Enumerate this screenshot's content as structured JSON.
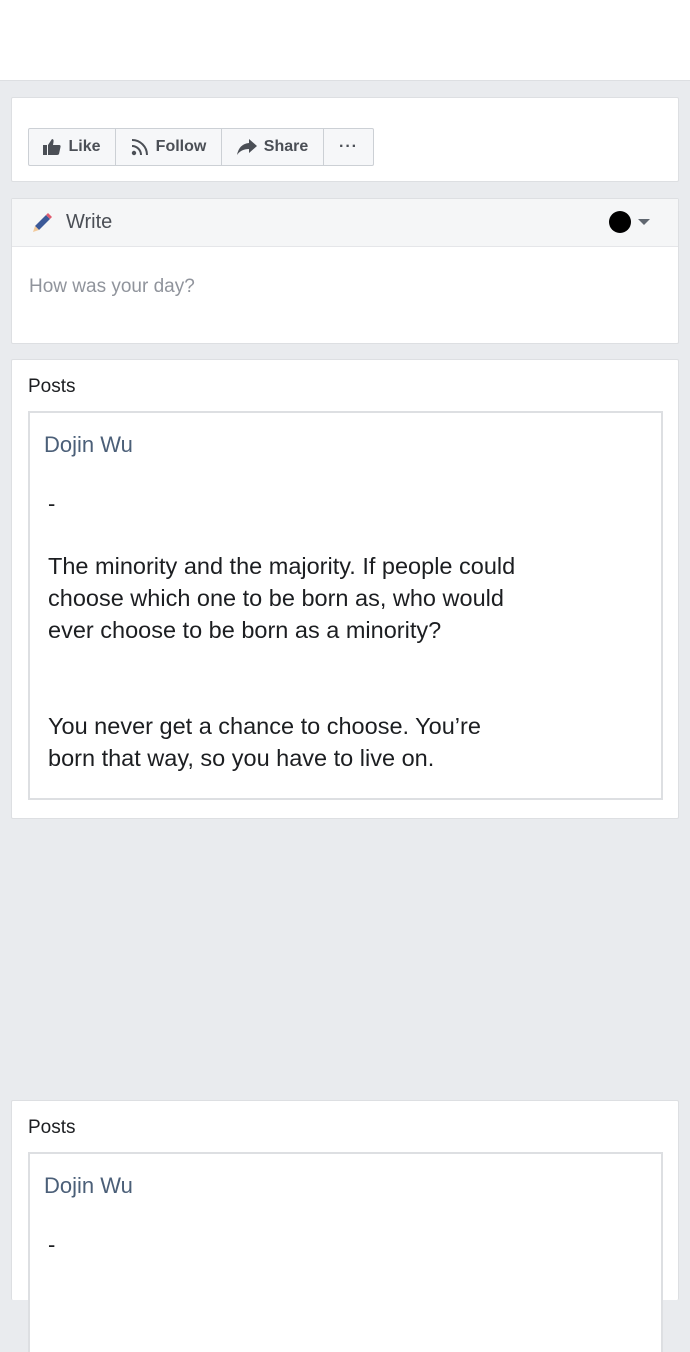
{
  "actions": {
    "like": "Like",
    "follow": "Follow",
    "share": "Share",
    "more": "···"
  },
  "composer": {
    "title": "Write",
    "placeholder": "How was your day?"
  },
  "posts": [
    {
      "section_title": "Posts",
      "author": "Dojin Wu",
      "lead": "-",
      "paragraphs": [
        "The minority and the majority. If people could choose which one to be born as, who would ever choose to be born as a minority?",
        "You never get a chance to choose. You’re born that way, so you have to live on."
      ]
    },
    {
      "section_title": "Posts",
      "author": "Dojin Wu",
      "lead": "-"
    }
  ],
  "icons": {
    "like": "thumbs-up-icon",
    "follow": "rss-icon",
    "share": "share-arrow-icon",
    "more": "ellipsis-icon",
    "write": "pencil-icon",
    "privacy": "privacy-dot-icon"
  }
}
